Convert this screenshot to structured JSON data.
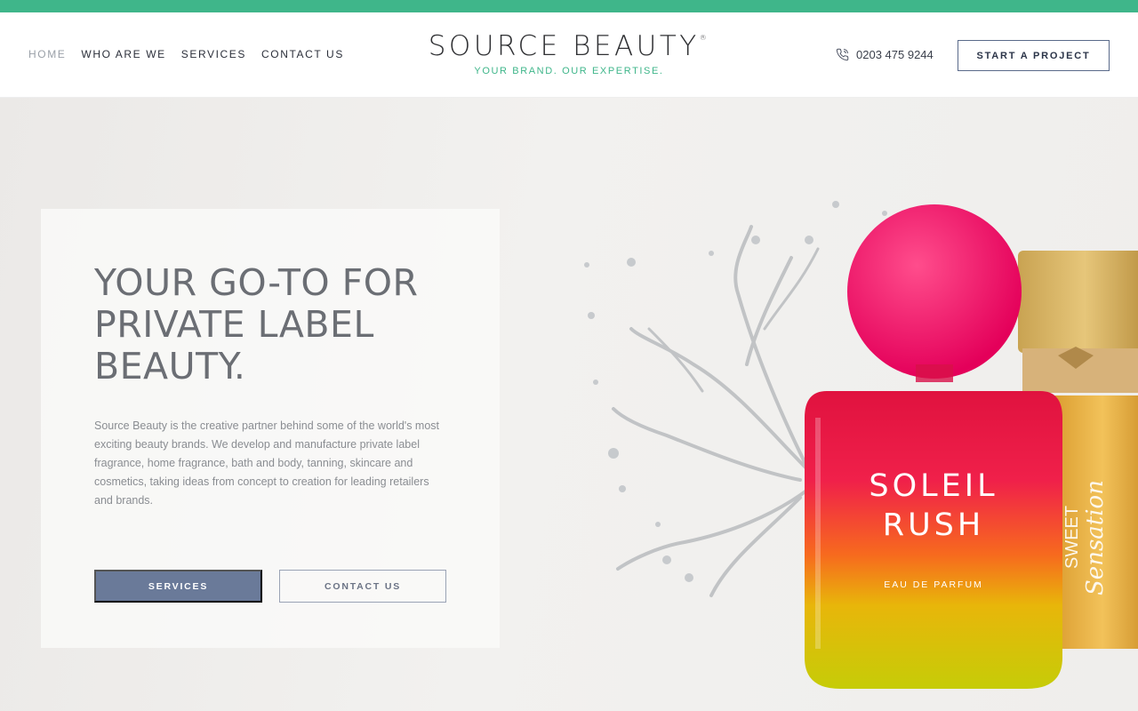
{
  "nav": {
    "items": [
      {
        "label": "HOME",
        "active": true
      },
      {
        "label": "WHO ARE WE",
        "active": false
      },
      {
        "label": "SERVICES",
        "active": false
      },
      {
        "label": "CONTACT US",
        "active": false
      }
    ]
  },
  "logo": {
    "name": "SOURCE BEAUTY",
    "registered": "®",
    "tagline": "YOUR BRAND. OUR EXPERTISE."
  },
  "header": {
    "phone": "0203 475 9244",
    "cta_label": "START A PROJECT"
  },
  "hero": {
    "heading": "YOUR GO-TO FOR PRIVATE LABEL BEAUTY.",
    "body": "Source Beauty is the creative partner behind some of the world's most exciting beauty brands. We develop and manufacture private label fragrance, home fragrance, bath and body, tanning, skincare and cosmetics, taking ideas from concept to creation for leading retailers and brands.",
    "primary_button": "SERVICES",
    "secondary_button": "CONTACT US"
  },
  "product": {
    "bottle_name_line1": "SOLEIL",
    "bottle_name_line2": "RUSH",
    "bottle_type": "EAU DE PARFUM",
    "second_bottle_text": "SWEET",
    "second_bottle_script": "Sensation"
  },
  "colors": {
    "accent": "#3fb68a",
    "button": "#6a7a99"
  },
  "icons": {
    "phone": "phone-icon"
  }
}
